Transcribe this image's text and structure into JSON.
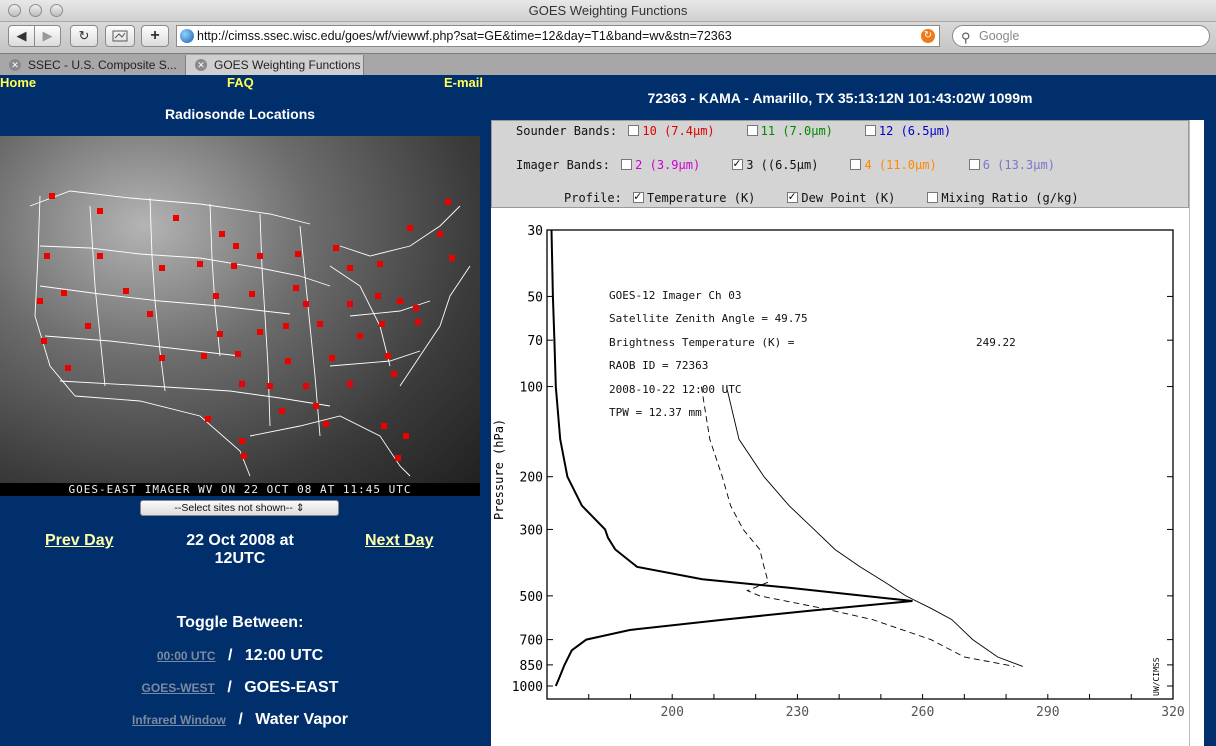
{
  "window": {
    "title": "GOES Weighting Functions"
  },
  "toolbar": {
    "url": "http://cimss.ssec.wisc.edu/goes/wf/viewwf.php?sat=GE&time=12&day=T1&band=wv&stn=72363",
    "search_placeholder": "Google",
    "back": "◀",
    "forward": "▶",
    "reload": "↻",
    "add": "+"
  },
  "tabs": [
    {
      "label": "SSEC - U.S. Composite S..."
    },
    {
      "label": "GOES Weighting Functions"
    }
  ],
  "nav": {
    "home": "Home",
    "faq": "FAQ",
    "email": "E-mail"
  },
  "left": {
    "heading": "Radiosonde Locations",
    "map_caption": "GOES-EAST IMAGER WV ON 22 OCT 08 AT 11:45 UTC",
    "select_value": "--Select sites not shown--",
    "prev_day": "Prev Day",
    "next_day": "Next Day",
    "date_line1": "22 Oct 2008 at",
    "date_line2": "12UTC",
    "toggle_heading": "Toggle Between:",
    "time_link": "00:00 UTC",
    "time_current": "12:00 UTC",
    "sat_link": "GOES-WEST",
    "sat_current": "GOES-EAST",
    "band_link": "Infrared Window",
    "band_current": "Water Vapor",
    "sep": "/"
  },
  "station_title": "72363 - KAMA - Amarillo, TX 35:13:12N 101:43:02W 1099m",
  "bands": {
    "sounder_label": "Sounder Bands:",
    "sounder": [
      {
        "label": "10 (7.4µm)",
        "color": "#e00000",
        "checked": false
      },
      {
        "label": "11 (7.0µm)",
        "color": "#008800",
        "checked": false
      },
      {
        "label": "12 (6.5µm)",
        "color": "#0000cc",
        "checked": false
      }
    ],
    "imager_label": "Imager  Bands:",
    "imager": [
      {
        "label": "2 (3.9µm)",
        "color": "#cc00cc",
        "checked": false
      },
      {
        "label": "3 ((6.5µm)",
        "color": "#111111",
        "checked": true
      },
      {
        "label": "4 (11.0µm)",
        "color": "#ff8800",
        "checked": false
      },
      {
        "label": "6 (13.3µm)",
        "color": "#7777cc",
        "checked": false
      }
    ],
    "profile_label": "Profile:",
    "profile": [
      {
        "label": "Temperature (K)",
        "checked": true
      },
      {
        "label": "Dew Point (K)",
        "checked": true
      },
      {
        "label": "Mixing Ratio (g/kg)",
        "checked": false
      }
    ]
  },
  "chart_data": {
    "type": "line",
    "ylabel": "Pressure (hPa)",
    "y_ticks": [
      "30",
      "50",
      "70",
      "100",
      "200",
      "300",
      "500",
      "700",
      "850",
      "1000"
    ],
    "x_ticks": [
      "200",
      "230",
      "260",
      "290",
      "320"
    ],
    "xlim": [
      170,
      320
    ],
    "y_log": true,
    "info": {
      "line1": "GOES-12 Imager  Ch    03",
      "line2": "Satellite Zenith Angle = 49.75",
      "line3_label": "Brightness Temperature (K) =",
      "line3_value": "249.22",
      "line4": "RAOB ID = 72363",
      "line5": "2008-10-22 12:00 UTC",
      "line6": "TPW = 12.37 mm"
    },
    "credit": "UW/CIMSS",
    "series": [
      {
        "id": "weighting",
        "points": [
          [
            30,
            1
          ],
          [
            50,
            2
          ],
          [
            70,
            3
          ],
          [
            100,
            4
          ],
          [
            150,
            7
          ],
          [
            200,
            12
          ],
          [
            250,
            22
          ],
          [
            300,
            38
          ],
          [
            320,
            40
          ],
          [
            350,
            45
          ],
          [
            400,
            60
          ],
          [
            440,
            105
          ],
          [
            470,
            165
          ],
          [
            490,
            200
          ],
          [
            520,
            250
          ],
          [
            560,
            180
          ],
          [
            600,
            120
          ],
          [
            650,
            55
          ],
          [
            700,
            25
          ],
          [
            760,
            15
          ],
          [
            850,
            10
          ],
          [
            950,
            6
          ],
          [
            1000,
            4
          ]
        ]
      },
      {
        "id": "temperature",
        "points": [
          [
            100,
            213
          ],
          [
            150,
            216
          ],
          [
            200,
            222
          ],
          [
            250,
            228
          ],
          [
            300,
            234
          ],
          [
            350,
            239
          ],
          [
            400,
            245
          ],
          [
            450,
            251
          ],
          [
            500,
            256
          ],
          [
            550,
            262
          ],
          [
            600,
            267
          ],
          [
            700,
            272
          ],
          [
            800,
            278
          ],
          [
            860,
            284
          ]
        ]
      },
      {
        "id": "dewpoint",
        "points": [
          [
            100,
            207
          ],
          [
            150,
            209
          ],
          [
            200,
            212
          ],
          [
            250,
            214
          ],
          [
            300,
            217
          ],
          [
            350,
            221
          ],
          [
            400,
            222
          ],
          [
            450,
            223
          ],
          [
            480,
            218
          ],
          [
            500,
            221
          ],
          [
            550,
            236
          ],
          [
            600,
            248
          ],
          [
            700,
            262
          ],
          [
            800,
            270
          ],
          [
            860,
            282
          ]
        ]
      }
    ]
  }
}
